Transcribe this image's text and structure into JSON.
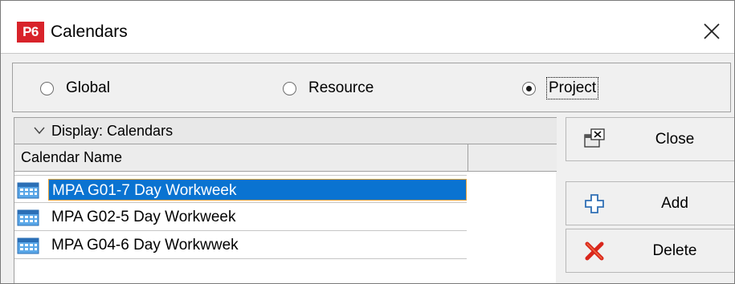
{
  "window": {
    "app_icon_text": "P6",
    "title": "Calendars",
    "close_icon": "close-icon"
  },
  "radio_group": {
    "options": [
      {
        "label": "Global",
        "selected": false
      },
      {
        "label": "Resource",
        "selected": false
      },
      {
        "label": "Project",
        "selected": true
      }
    ]
  },
  "table": {
    "display_label": "Display: Calendars",
    "columns": [
      "Calendar Name"
    ],
    "rows": [
      {
        "name": "MPA G01-7 Day Workweek",
        "selected": true,
        "icon": "calendar-icon"
      },
      {
        "name": "MPA G02-5 Day Workweek",
        "selected": false,
        "icon": "calendar-icon"
      },
      {
        "name": "MPA G04-6 Day Workwwek",
        "selected": false,
        "icon": "calendar-icon"
      }
    ]
  },
  "buttons": {
    "close": {
      "label": "Close",
      "icon": "close-window-icon"
    },
    "add": {
      "label": "Add",
      "icon": "plus-icon"
    },
    "delete": {
      "label": "Delete",
      "icon": "delete-x-icon"
    }
  },
  "colors": {
    "accent_selection": "#0a73d1",
    "app_icon_red": "#d8232a",
    "delete_red": "#d9261c",
    "add_blue": "#2f6fb5"
  }
}
